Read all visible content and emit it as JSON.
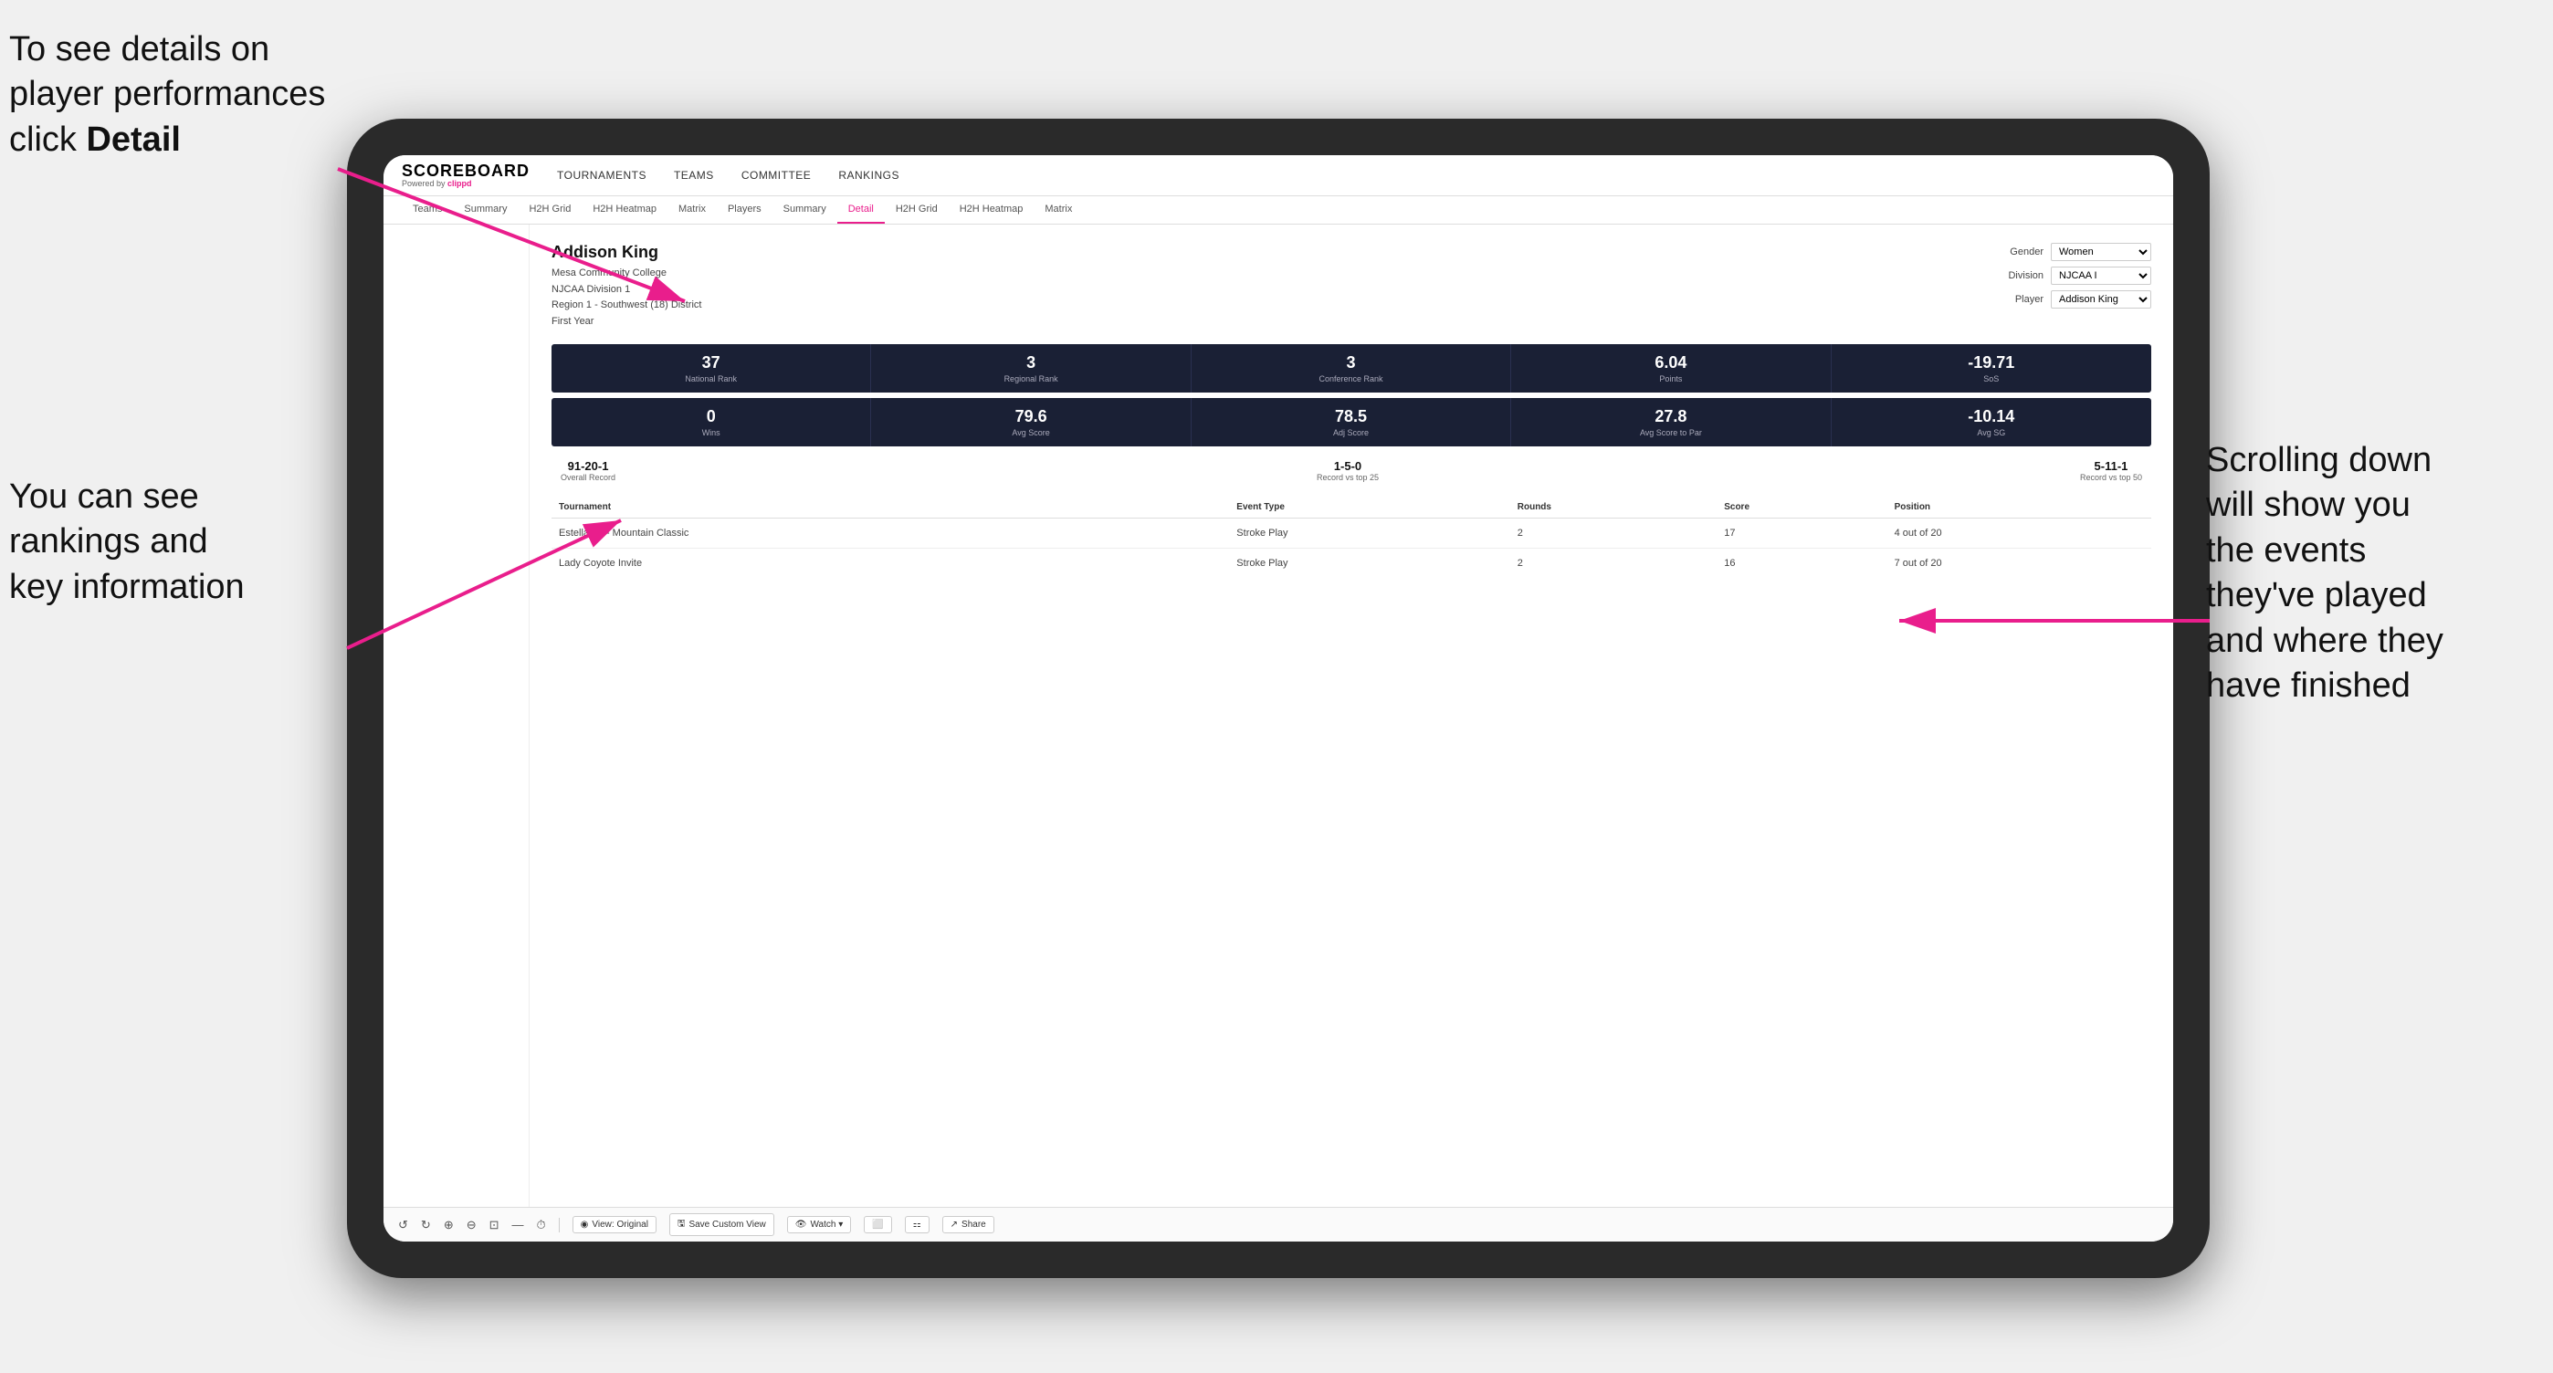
{
  "annotations": {
    "top_left": "To see details on player performances click ",
    "top_left_bold": "Detail",
    "bottom_left_line1": "You can see",
    "bottom_left_line2": "rankings and",
    "bottom_left_line3": "key information",
    "right_line1": "Scrolling down",
    "right_line2": "will show you",
    "right_line3": "the events",
    "right_line4": "they've played",
    "right_line5": "and where they",
    "right_line6": "have finished"
  },
  "nav": {
    "logo": "SCOREBOARD",
    "logo_sub": "Powered by ",
    "logo_brand": "clippd",
    "links": [
      "TOURNAMENTS",
      "TEAMS",
      "COMMITTEE",
      "RANKINGS"
    ]
  },
  "sub_nav": {
    "links": [
      "Teams",
      "Summary",
      "H2H Grid",
      "H2H Heatmap",
      "Matrix",
      "Players",
      "Summary",
      "Detail",
      "H2H Grid",
      "H2H Heatmap",
      "Matrix"
    ],
    "active": "Detail"
  },
  "player": {
    "name": "Addison King",
    "college": "Mesa Community College",
    "division": "NJCAA Division 1",
    "region": "Region 1 - Southwest (18) District",
    "year": "First Year"
  },
  "controls": {
    "gender_label": "Gender",
    "gender_value": "Women",
    "division_label": "Division",
    "division_value": "NJCAA I",
    "player_label": "Player",
    "player_value": "Addison King"
  },
  "stats_row1": [
    {
      "value": "37",
      "label": "National Rank"
    },
    {
      "value": "3",
      "label": "Regional Rank"
    },
    {
      "value": "3",
      "label": "Conference Rank"
    },
    {
      "value": "6.04",
      "label": "Points"
    },
    {
      "value": "-19.71",
      "label": "SoS"
    }
  ],
  "stats_row2": [
    {
      "value": "0",
      "label": "Wins"
    },
    {
      "value": "79.6",
      "label": "Avg Score"
    },
    {
      "value": "78.5",
      "label": "Adj Score"
    },
    {
      "value": "27.8",
      "label": "Avg Score to Par"
    },
    {
      "value": "-10.14",
      "label": "Avg SG"
    }
  ],
  "records": [
    {
      "value": "91-20-1",
      "label": "Overall Record"
    },
    {
      "value": "1-5-0",
      "label": "Record vs top 25"
    },
    {
      "value": "5-11-1",
      "label": "Record vs top 50"
    }
  ],
  "table": {
    "headers": [
      "Tournament",
      "",
      "Event Type",
      "Rounds",
      "Score",
      "Position"
    ],
    "rows": [
      {
        "tournament": "Estella CC- Mountain Classic",
        "event_type": "Stroke Play",
        "rounds": "2",
        "score": "17",
        "position": "4 out of 20"
      },
      {
        "tournament": "Lady Coyote Invite",
        "event_type": "Stroke Play",
        "rounds": "2",
        "score": "16",
        "position": "7 out of 20"
      }
    ]
  },
  "toolbar": {
    "items": [
      "↺",
      "↻",
      "⊕",
      "⊖",
      "⊡",
      "—",
      "⏱"
    ],
    "view_label": "View: Original",
    "save_label": "Save Custom View",
    "watch_label": "Watch ▾",
    "share_label": "Share"
  }
}
